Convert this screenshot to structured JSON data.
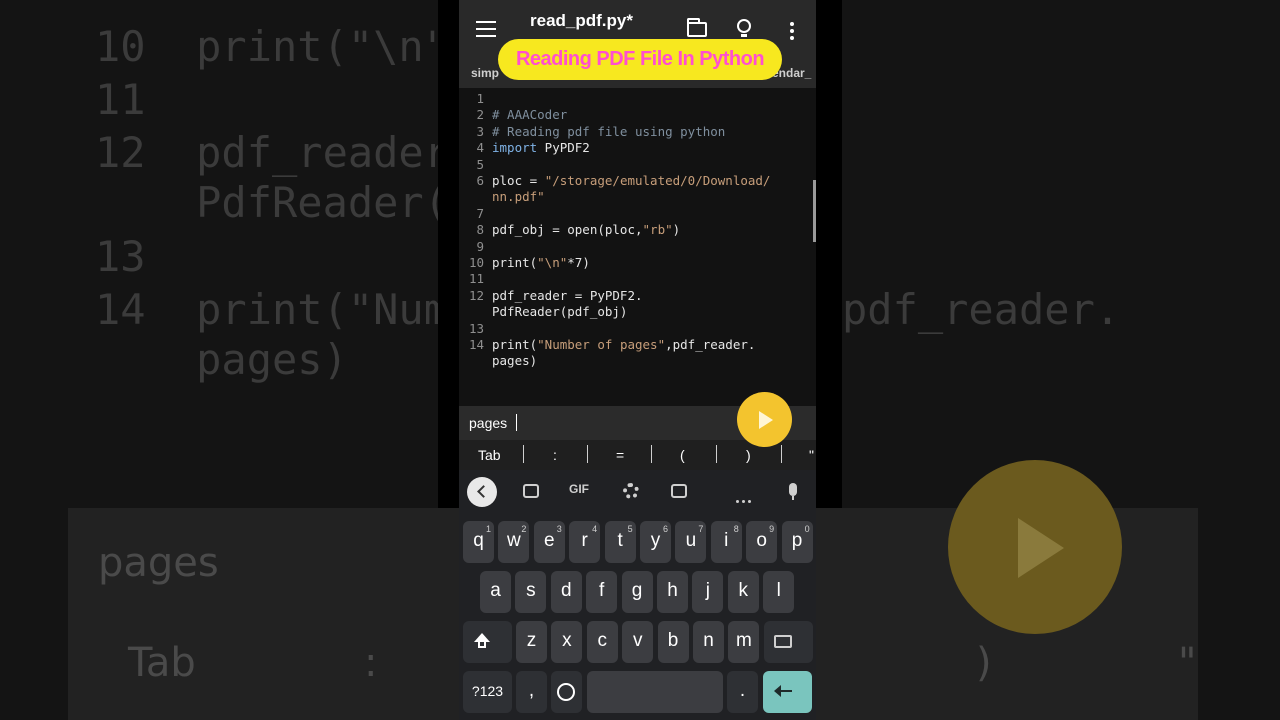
{
  "background": {
    "code_lines": [
      "10  print(\"\\n\"",
      "11",
      "12  pdf_reader",
      "    PdfReader(",
      "13",
      "14  print(\"Num",
      "    pages)"
    ],
    "right_code": "pdf_reader.",
    "suggest_word": "pages",
    "tab_label": "Tab",
    "colon": ":",
    "paren": ")",
    "quote": "\""
  },
  "appbar": {
    "title": "read_pdf.py*",
    "banner": "Reading PDF File In Python",
    "tab_left": "simp",
    "tab_right": "endar_"
  },
  "editor": {
    "lines": [
      {
        "num": "1",
        "text": ""
      },
      {
        "num": "2",
        "text": "# AAACoder"
      },
      {
        "num": "3",
        "text": "# Reading pdf file using python"
      },
      {
        "num": "4",
        "kw": "import",
        "rest": " PyPDF2"
      },
      {
        "num": "5",
        "text": ""
      },
      {
        "num": "6",
        "pre": "ploc = ",
        "str": "\"/storage/emulated/0/Download/"
      },
      {
        "num": "",
        "str": "nn.pdf\""
      },
      {
        "num": "7",
        "text": ""
      },
      {
        "num": "8",
        "pre": "pdf_obj = open(ploc,",
        "str": "\"rb\"",
        "post": ")"
      },
      {
        "num": "9",
        "text": ""
      },
      {
        "num": "10",
        "pre": "print(",
        "str": "\"\\n\"",
        "post": "*7)"
      },
      {
        "num": "11",
        "text": ""
      },
      {
        "num": "12",
        "text": "pdf_reader = PyPDF2."
      },
      {
        "num": "",
        "text": "PdfReader(pdf_obj)"
      },
      {
        "num": "13",
        "text": ""
      },
      {
        "num": "14",
        "pre": "print(",
        "str": "\"Number of pages\"",
        "post": ",pdf_reader."
      },
      {
        "num": "",
        "text": "pages)"
      }
    ]
  },
  "suggestion": {
    "word": "pages"
  },
  "symbols": [
    "Tab",
    ":",
    "=",
    "(",
    ")",
    "\""
  ],
  "keyboard": {
    "gif_label": "GIF",
    "row1": [
      {
        "k": "q",
        "n": "1"
      },
      {
        "k": "w",
        "n": "2"
      },
      {
        "k": "e",
        "n": "3"
      },
      {
        "k": "r",
        "n": "4"
      },
      {
        "k": "t",
        "n": "5"
      },
      {
        "k": "y",
        "n": "6"
      },
      {
        "k": "u",
        "n": "7"
      },
      {
        "k": "i",
        "n": "8"
      },
      {
        "k": "o",
        "n": "9"
      },
      {
        "k": "p",
        "n": "0"
      }
    ],
    "row2": [
      "a",
      "s",
      "d",
      "f",
      "g",
      "h",
      "j",
      "k",
      "l"
    ],
    "row3": [
      "z",
      "x",
      "c",
      "v",
      "b",
      "n",
      "m"
    ],
    "num_key": "?123",
    "comma": ",",
    "period": "."
  }
}
